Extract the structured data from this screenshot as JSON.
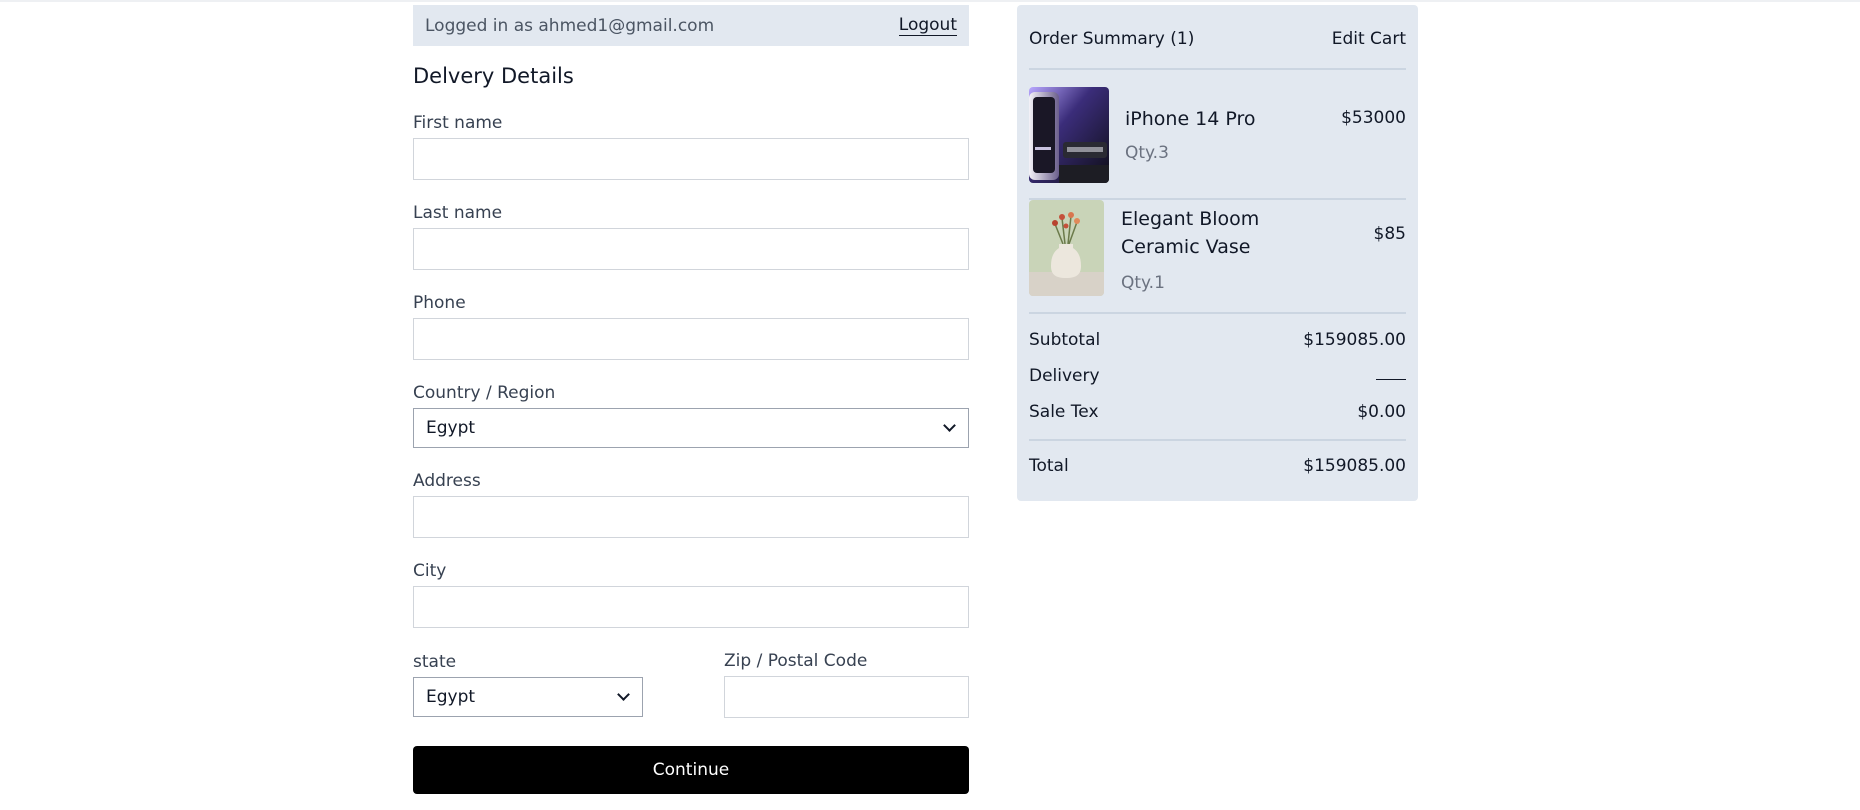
{
  "account": {
    "logged_in_text": "Logged in as ahmed1@gmail.com",
    "logout_label": "Logout"
  },
  "delivery": {
    "title": "Delvery Details",
    "first_name_label": "First name",
    "first_name_value": "",
    "last_name_label": "Last name",
    "last_name_value": "",
    "phone_label": "Phone",
    "phone_value": "",
    "country_label": "Country / Region",
    "country_value": "Egypt",
    "address_label": "Address",
    "address_value": "",
    "city_label": "City",
    "city_value": "",
    "state_label": "state",
    "state_value": "Egypt",
    "zip_label": "Zip / Postal Code",
    "zip_value": "",
    "continue_label": "Continue"
  },
  "summary": {
    "title": "Order Summary (1)",
    "edit_cart_label": "Edit Cart",
    "items": [
      {
        "name": "iPhone 14 Pro",
        "qty": "Qty.3",
        "price": "$53000"
      },
      {
        "name": "Elegant Bloom Ceramic Vase",
        "qty": "Qty.1",
        "price": "$85"
      }
    ],
    "subtotal_label": "Subtotal",
    "subtotal_value": "$159085.00",
    "delivery_label": "Delivery",
    "sale_tax_label": "Sale Tex",
    "sale_tax_value": "$0.00",
    "total_label": "Total",
    "total_value": "$159085.00"
  },
  "colors": {
    "panel_bg": "#e2e8f0",
    "button_bg": "#000000",
    "button_text": "#ffffff"
  }
}
